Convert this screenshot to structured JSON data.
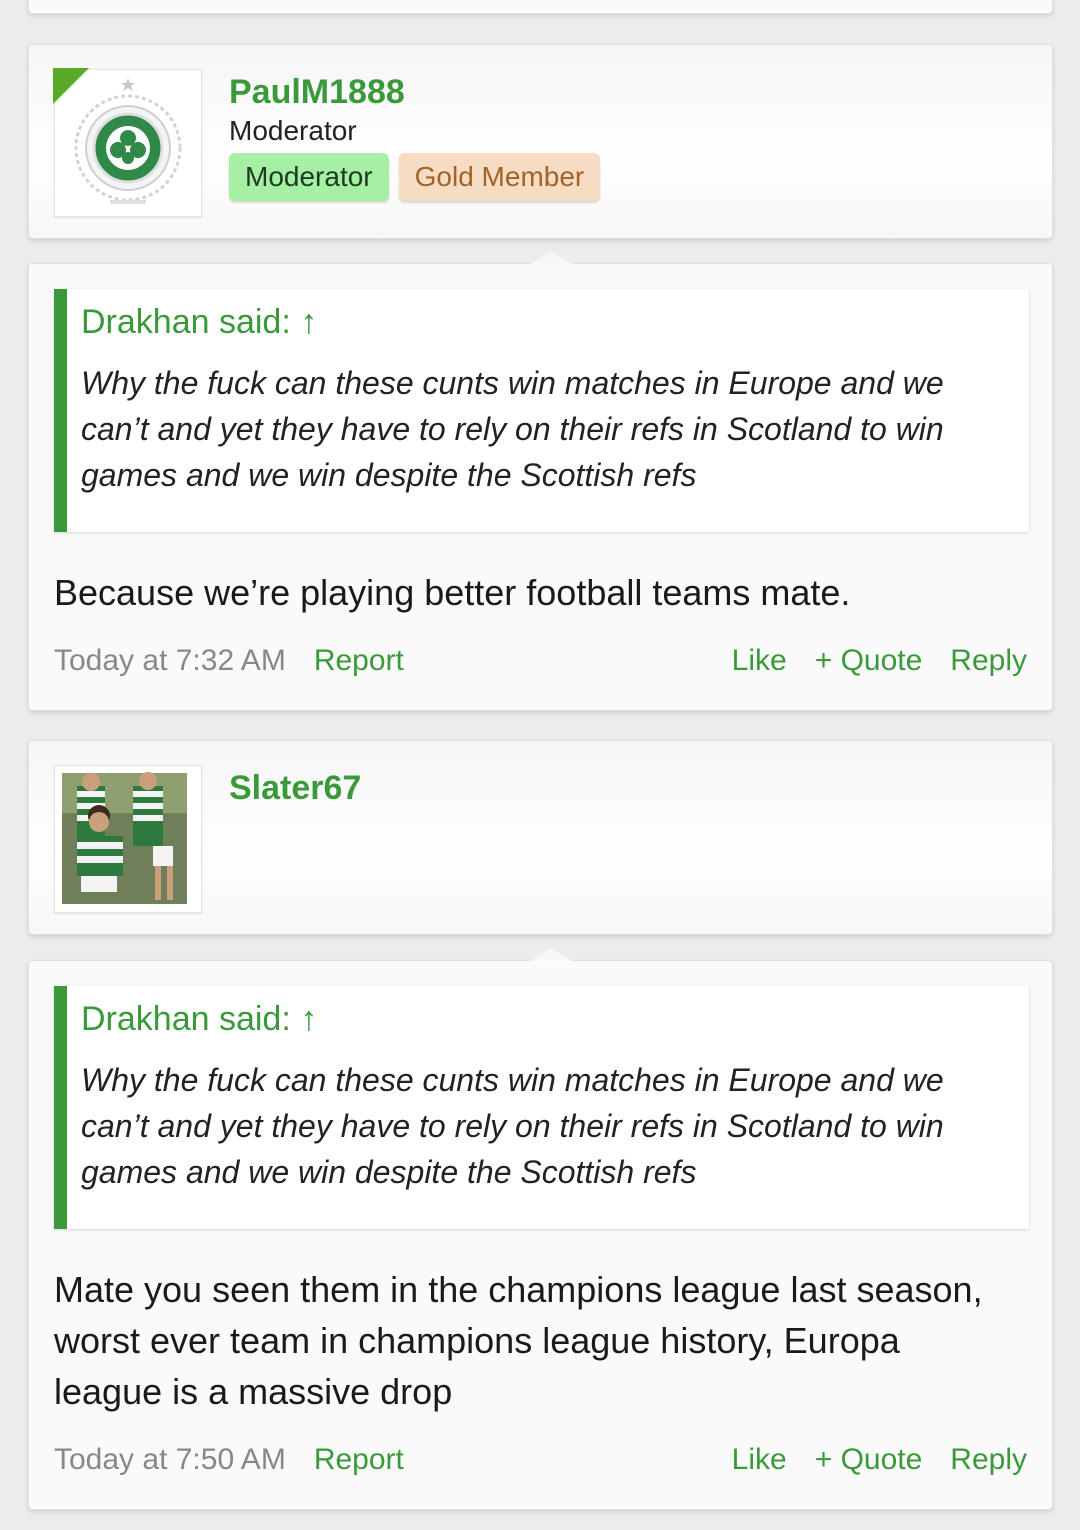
{
  "posts": [
    {
      "username": "PaulM1888",
      "user_title": "Moderator",
      "badges": [
        "Moderator",
        "Gold Member"
      ],
      "avatar_icon": "celtic-crest-icon",
      "quote_author": "Drakhan said: ↑",
      "quote_text": "Why the fuck can these cunts win matches in Europe and we can’t and yet they have to rely on their refs in Scotland to win games and we win despite the Scottish refs",
      "body": "Because we’re playing better football teams mate.",
      "time": "Today at 7:32 AM",
      "report": "Report",
      "like": "Like",
      "quote": "+ Quote",
      "reply": "Reply"
    },
    {
      "username": "Slater67",
      "avatar_icon": "team-photo-avatar",
      "quote_author": "Drakhan said: ↑",
      "quote_text": "Why the fuck can these cunts win matches in Europe and we can’t and yet they have to rely on their refs in Scotland to win games and we win despite the Scottish refs",
      "body": "Mate you seen them in the champions league last season, worst ever team in champions league history, Europa league is a massive drop",
      "time": "Today at 7:50 AM",
      "report": "Report",
      "like": "Like",
      "quote": "+ Quote",
      "reply": "Reply"
    }
  ],
  "colors": {
    "accent": "#3a9a3a",
    "moderator_badge_bg": "#a5f0a5",
    "gold_badge_bg": "#f7dcc4",
    "gold_badge_text": "#a0632a"
  }
}
